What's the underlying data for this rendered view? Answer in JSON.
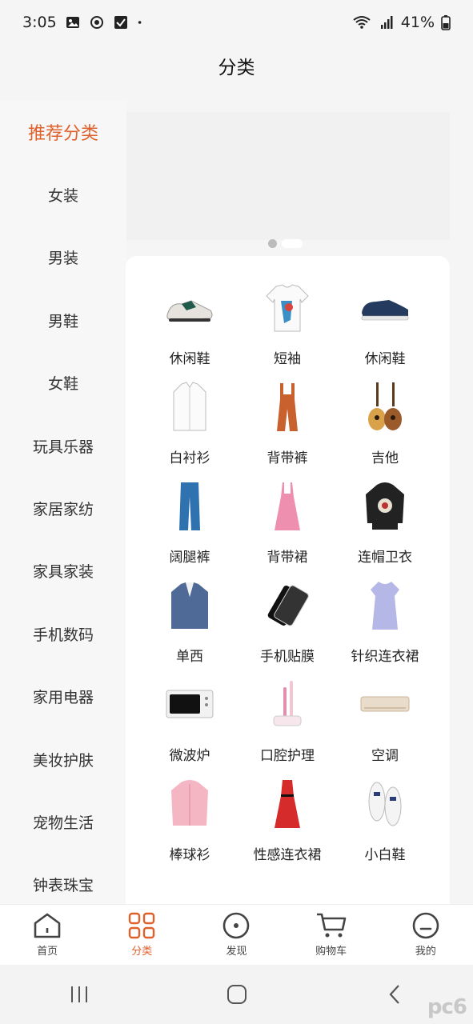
{
  "status": {
    "time": "3:05",
    "battery": "41%"
  },
  "header": {
    "title": "分类"
  },
  "sidebar": {
    "items": [
      {
        "label": "推荐分类",
        "active": true
      },
      {
        "label": "女装"
      },
      {
        "label": "男装"
      },
      {
        "label": "男鞋"
      },
      {
        "label": "女鞋"
      },
      {
        "label": "玩具乐器"
      },
      {
        "label": "家居家纺"
      },
      {
        "label": "家具家装"
      },
      {
        "label": "手机数码"
      },
      {
        "label": "家用电器"
      },
      {
        "label": "美妆护肤"
      },
      {
        "label": "宠物生活"
      },
      {
        "label": "钟表珠宝"
      }
    ]
  },
  "grid": {
    "items": [
      {
        "label": "休闲鞋",
        "icon": "sneaker-icon"
      },
      {
        "label": "短袖",
        "icon": "tshirt-icon"
      },
      {
        "label": "休闲鞋",
        "icon": "canvas-shoe-icon"
      },
      {
        "label": "白衬衫",
        "icon": "shirt-icon"
      },
      {
        "label": "背带裤",
        "icon": "overalls-icon"
      },
      {
        "label": "吉他",
        "icon": "guitar-icon"
      },
      {
        "label": "阔腿裤",
        "icon": "pants-icon"
      },
      {
        "label": "背带裙",
        "icon": "dress-icon"
      },
      {
        "label": "连帽卫衣",
        "icon": "hoodie-icon"
      },
      {
        "label": "单西",
        "icon": "blazer-icon"
      },
      {
        "label": "手机贴膜",
        "icon": "screen-film-icon"
      },
      {
        "label": "针织连衣裙",
        "icon": "knit-dress-icon"
      },
      {
        "label": "微波炉",
        "icon": "microwave-icon"
      },
      {
        "label": "口腔护理",
        "icon": "toothbrush-icon"
      },
      {
        "label": "空调",
        "icon": "aircon-icon"
      },
      {
        "label": "棒球衫",
        "icon": "jacket-icon"
      },
      {
        "label": "性感连衣裙",
        "icon": "red-dress-icon"
      },
      {
        "label": "小白鞋",
        "icon": "white-shoe-icon"
      }
    ]
  },
  "tabbar": {
    "items": [
      {
        "label": "首页",
        "icon": "home-icon"
      },
      {
        "label": "分类",
        "icon": "category-icon",
        "active": true
      },
      {
        "label": "发现",
        "icon": "discover-icon"
      },
      {
        "label": "购物车",
        "icon": "cart-icon"
      },
      {
        "label": "我的",
        "icon": "profile-icon"
      }
    ]
  },
  "colors": {
    "accent": "#e0602c"
  },
  "watermark": "pc6"
}
